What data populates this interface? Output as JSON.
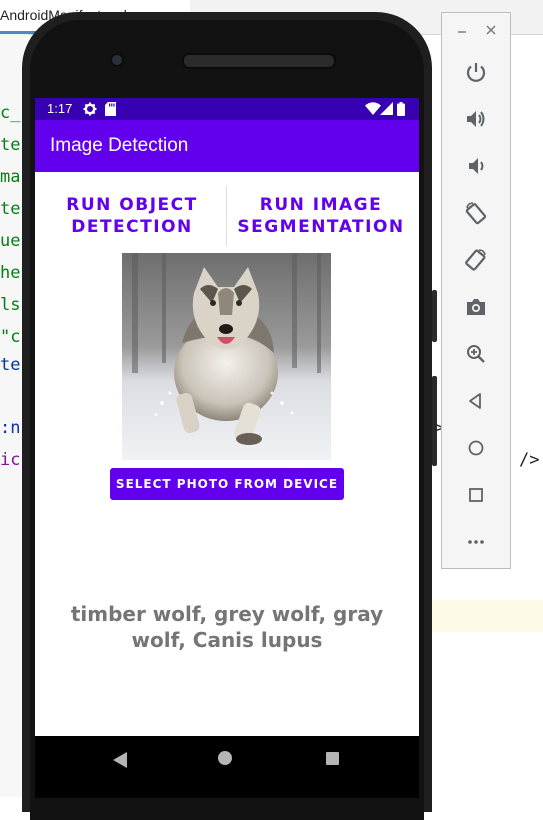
{
  "ide": {
    "tab_label": "AndroidManifest.xml",
    "code_fragments": [
      "c_",
      "te",
      "ma",
      "te",
      "ue",
      "he",
      "ls",
      "\"c",
      "te",
      ":n",
      "ic"
    ],
    "right_text_1": ">",
    "right_text_2": "/>"
  },
  "status_bar": {
    "time": "1:17",
    "icons": [
      "gear-icon",
      "sd-card-icon",
      "wifi-icon",
      "signal-icon",
      "battery-icon"
    ]
  },
  "app": {
    "title": "Image Detection",
    "run_object_detection_label": "RUN OBJECT DETECTION",
    "run_image_segmentation_label": "RUN IMAGE SEGMENTATION",
    "select_photo_label": "SELECT PHOTO FROM DEVICE",
    "result_text": "timber wolf, grey wolf, gray wolf, Canis lupus",
    "accent_color": "#6200ee",
    "status_bar_color": "#3700b3"
  },
  "nav_bar": {
    "buttons": [
      "back-icon",
      "home-icon",
      "recents-icon"
    ]
  },
  "emulator_toolbar": {
    "window_controls": [
      "minimize-icon",
      "close-icon"
    ],
    "tools": [
      "power-icon",
      "volume-up-icon",
      "volume-down-icon",
      "rotate-left-icon",
      "rotate-right-icon",
      "camera-icon",
      "zoom-icon",
      "back-icon",
      "home-icon",
      "overview-icon",
      "more-icon"
    ]
  }
}
